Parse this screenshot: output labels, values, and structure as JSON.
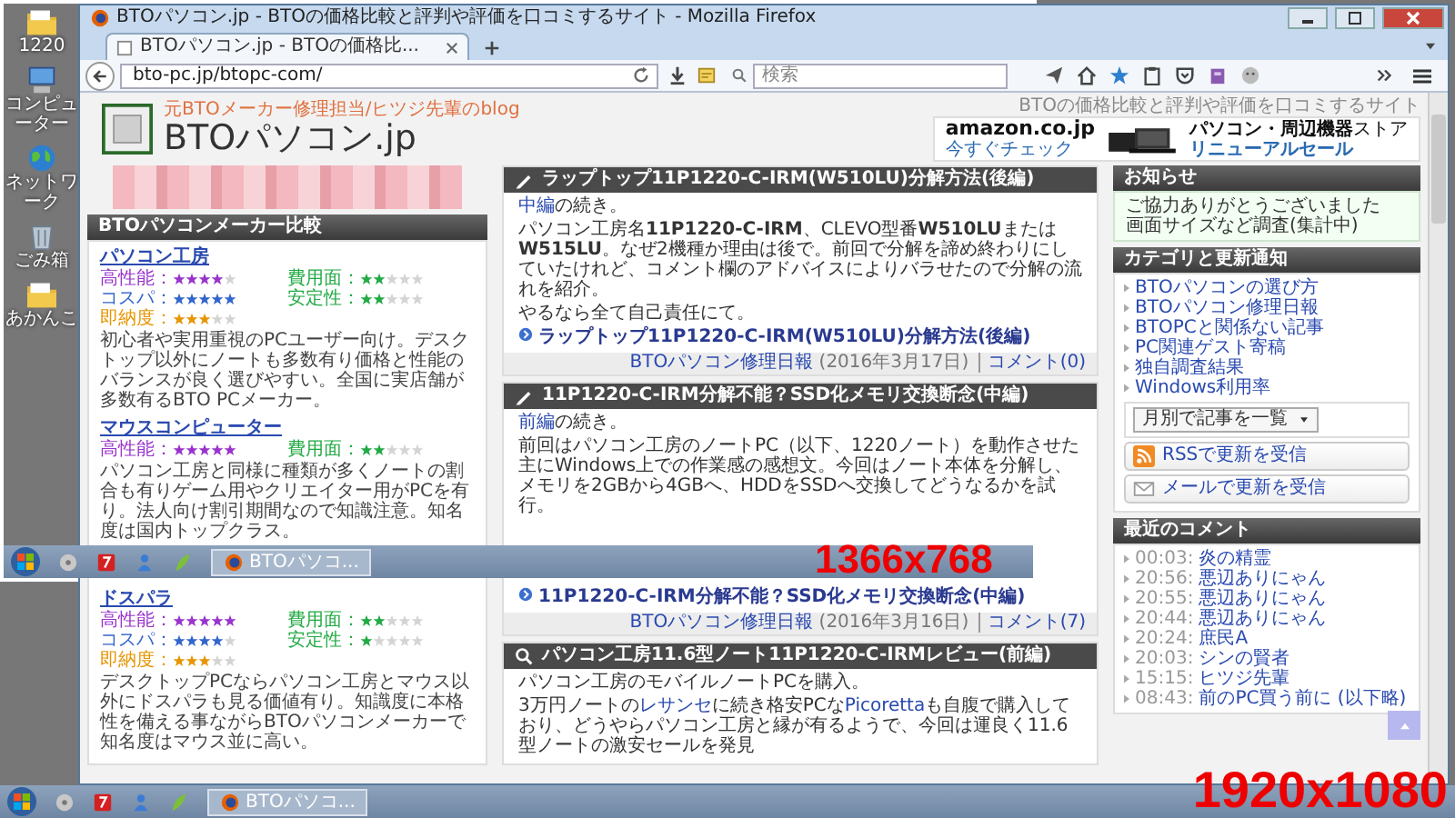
{
  "desktop_icons": [
    {
      "kind": "folder",
      "label": "1220"
    },
    {
      "kind": "computer",
      "label": "コンピューター"
    },
    {
      "kind": "network",
      "label": "ネットワーク"
    },
    {
      "kind": "trash",
      "label": "ごみ箱"
    },
    {
      "kind": "folder",
      "label": "あかんこ"
    }
  ],
  "browser": {
    "title": "BTOパソコン.jp - BTOの価格比較と評判や評価を口コミするサイト - Mozilla Firefox",
    "tabs": [
      {
        "label": "BTOパソコン.jp - BTOの価格比...",
        "selected": true
      }
    ],
    "url": "bto-pc.jp/btopc-com/",
    "search": {
      "placeholder": "検索"
    },
    "page": {
      "header": {
        "tagline": "BTOの価格比較と評判や評価を口コミするサイト",
        "subtitle": "元BTOメーカー修理担当/ヒツジ先輩のblog",
        "logo": "BTOパソコン.jp"
      },
      "ad": {
        "brand": "amazon.co.jp",
        "cta": "今すぐチェック",
        "store": "パソコン・周辺機器",
        "store_suffix": "ストア",
        "sale": "リニューアルセール"
      },
      "left": {
        "heading": "BTOパソコンメーカー比較",
        "makers": [
          {
            "name": "パソコン工房",
            "ratings": [
              {
                "label": "高性能：",
                "stars": 4,
                "color": "#9933cc"
              },
              {
                "label": "費用面：",
                "stars": 2,
                "color": "#22aa44"
              },
              {
                "label": "コスパ：",
                "stars": 5,
                "color": "#3366cc"
              },
              {
                "label": "安定性：",
                "stars": 2,
                "color": "#22aa44"
              },
              {
                "label": "即納度：",
                "stars": 3,
                "color": "#e69500"
              }
            ],
            "description": "初心者や実用重視のPCユーザー向け。デスクトップ以外にノートも多数有り価格と性能のバランスが良く選びやすい。全国に実店舗が多数有るBTO PCメーカー。"
          },
          {
            "name": "マウスコンピューター",
            "ratings": [
              {
                "label": "高性能：",
                "stars": 5,
                "color": "#9933cc"
              },
              {
                "label": "費用面：",
                "stars": 2,
                "color": "#22aa44"
              }
            ],
            "description": "パソコン工房と同様に種類が多くノートの割合も有りゲーム用やクリエイター用がPCを有り。法人向け割引期間なので知識注意。知名度は国内トップクラス。"
          },
          {
            "name": "ドスパラ",
            "ratings": [
              {
                "label": "高性能：",
                "stars": 5,
                "color": "#9933cc"
              },
              {
                "label": "費用面：",
                "stars": 2,
                "color": "#22aa44"
              },
              {
                "label": "コスパ：",
                "stars": 4,
                "color": "#3366cc"
              },
              {
                "label": "安定性：",
                "stars": 1,
                "color": "#22aa44"
              },
              {
                "label": "即納度：",
                "stars": 3,
                "color": "#e69500"
              }
            ],
            "description": "デスクトップPCならパソコン工房とマウス以外にドスパラも見る価値有り。知識度に本格性を備える事ながらBTOパソコンメーカーで知名度はマウス並に高い。"
          }
        ]
      },
      "articles": [
        {
          "kind": "pen",
          "title": "ラップトップ11P1220-C-IRM(W510LU)分解方法(後編)",
          "paragraphs": [
            [
              {
                "kind": "link",
                "text": "中編"
              },
              {
                "kind": "text",
                "text": "の続き。"
              }
            ],
            [
              {
                "kind": "text",
                "text": "パソコン工房名**11P1220-C-IRM**、CLEVO型番**W510LU**または**W515LU**。なぜ2機種か理由は後で。前回で分解を諦め終わりにしていたけれど、コメント欄のアドバイスによりバラせたので分解の流れを紹介。"
              }
            ],
            [
              {
                "kind": "text",
                "text": "やるなら全て自己責任にて。"
              }
            ]
          ],
          "link": "ラップトップ11P1220-C-IRM(W510LU)分解方法(後編)",
          "category": "BTOパソコン修理日報",
          "date": "(2016年3月17日)",
          "comments": "コメント(0)"
        },
        {
          "kind": "pen",
          "title": "11P1220-C-IRM分解不能？SSD化メモリ交換断念(中編)",
          "paragraphs": [
            [
              {
                "kind": "link",
                "text": "前編"
              },
              {
                "kind": "text",
                "text": "の続き。"
              }
            ],
            [
              {
                "kind": "text",
                "text": "前回はパソコン工房のノートPC（以下、1220ノート）を動作させた主にWindows上での作業感の感想文。今回はノート本体を分解し、メモリを2GBから4GBへ、HDDをSSDへ交換してどうなるかを試行。"
              }
            ]
          ],
          "link": "11P1220-C-IRM分解不能？SSD化メモリ交換断念(中編)",
          "category": "BTOパソコン修理日報",
          "date": "(2016年3月16日)",
          "comments": "コメント(7)"
        },
        {
          "kind": "search",
          "title": "パソコン工房11.6型ノート11P1220-C-IRMレビュー(前編)",
          "paragraphs": [
            [
              {
                "kind": "text",
                "text": "パソコン工房のモバイルノートPCを購入。"
              }
            ],
            [
              {
                "kind": "text",
                "text": "3万円ノートの"
              },
              {
                "kind": "link",
                "text": "レサンセ"
              },
              {
                "kind": "text",
                "text": "に続き格安PCな"
              },
              {
                "kind": "link",
                "text": "Picoretta"
              },
              {
                "kind": "text",
                "text": "も自腹で購入しており、どうやらパソコン工房と縁が有るようで、今回は運良く11.6型ノートの激安セールを発見"
              }
            ]
          ]
        }
      ],
      "right": {
        "notice": {
          "heading": "お知らせ",
          "items": [
            "ご協力ありがとうございました",
            "画面サイズなど調査(集計中)"
          ]
        },
        "categories": {
          "heading": "カテゴリと更新通知",
          "items": [
            "BTOパソコンの選び方",
            "BTOパソコン修理日報",
            "BTOPCと関係ない記事",
            "PC関連ゲスト寄稿",
            "独自調査結果",
            "Windows利用率"
          ],
          "dropdown": "月別で記事を一覧",
          "rss": "RSSで更新を受信",
          "mail": "メールで更新を受信"
        },
        "comments": {
          "heading": "最近のコメント",
          "items": [
            {
              "time": "00:03:",
              "name": "炎の精霊"
            },
            {
              "time": "20:56:",
              "name": "悪辺ありにゃん"
            },
            {
              "time": "20:55:",
              "name": "悪辺ありにゃん"
            },
            {
              "time": "20:44:",
              "name": "悪辺ありにゃん"
            },
            {
              "time": "20:24:",
              "name": "庶民A"
            },
            {
              "time": "20:03:",
              "name": "シンの賢者"
            },
            {
              "time": "15:15:",
              "name": "ヒツジ先輩"
            },
            {
              "time": "08:43:",
              "name": "前のPC買う前に (以下略)"
            }
          ]
        }
      }
    }
  },
  "taskbars": [
    {
      "button": "BTOパソコ..."
    },
    {
      "button": "BTOパソコ..."
    }
  ],
  "resolution_labels": [
    "1366x768",
    "1920x1080"
  ]
}
